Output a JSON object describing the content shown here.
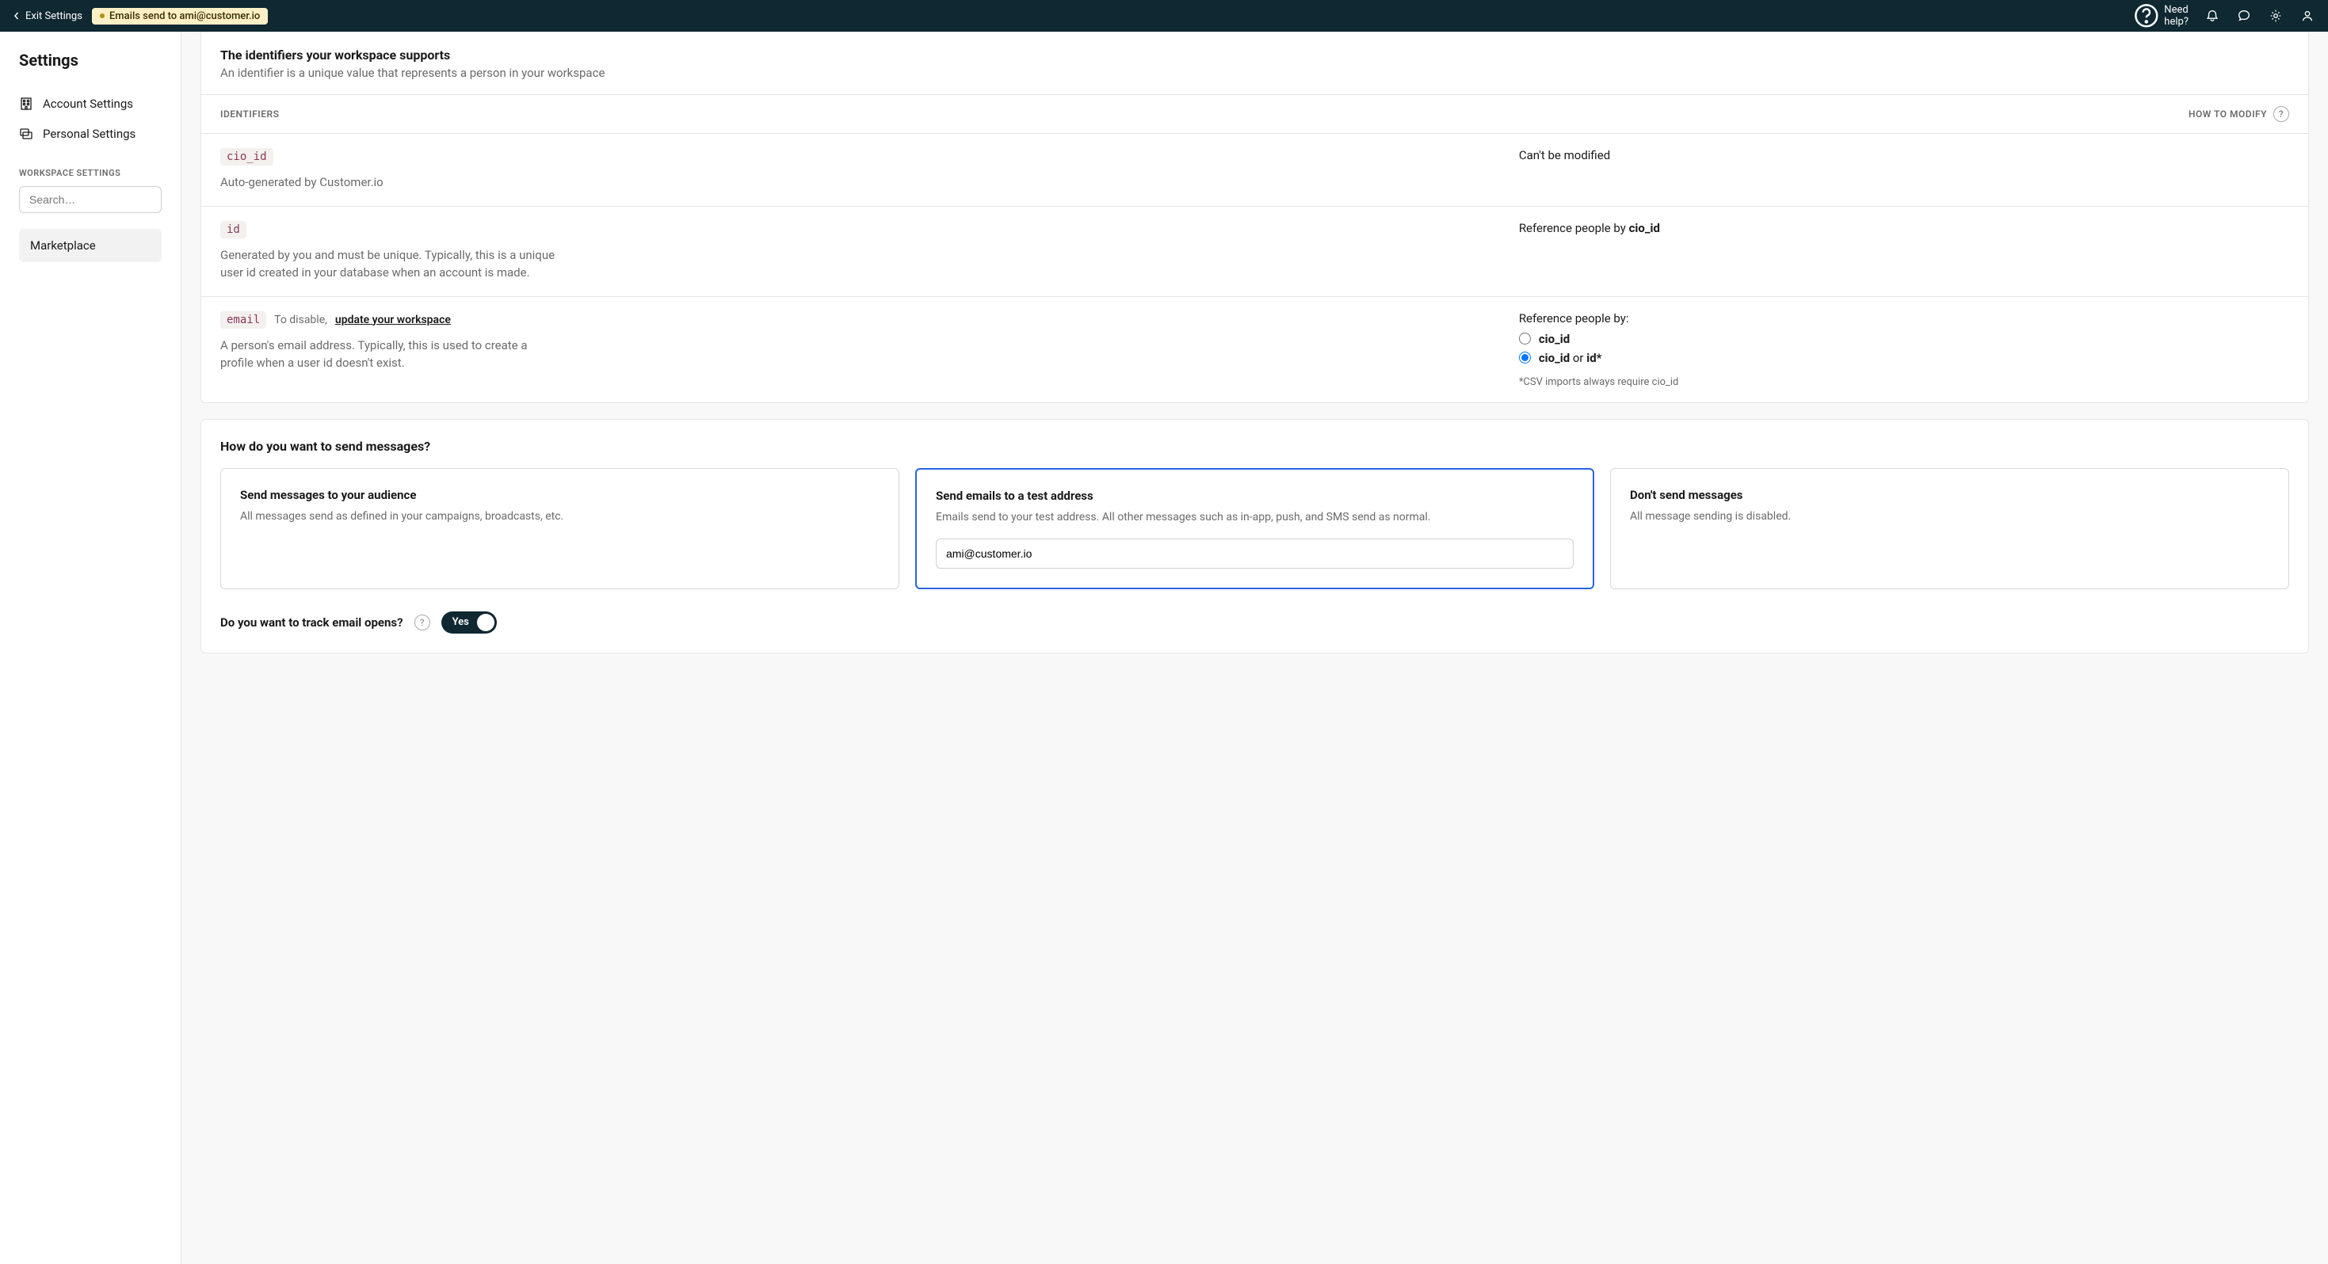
{
  "topbar": {
    "exit": "Exit Settings",
    "badge": "Emails send to ami@customer.io",
    "help": "Need help?"
  },
  "sidebar": {
    "title": "Settings",
    "nav": {
      "account": "Account Settings",
      "personal": "Personal Settings"
    },
    "workspace_label": "WORKSPACE SETTINGS",
    "search_placeholder": "Search…",
    "marketplace": "Marketplace"
  },
  "identifiers": {
    "title": "The identifiers your workspace supports",
    "subtitle": "An identifier is a unique value that represents a person in your workspace",
    "col_left": "IDENTIFIERS",
    "col_right": "HOW TO MODIFY",
    "rows": {
      "cio_id": {
        "tag": "cio_id",
        "desc": "Auto-generated by Customer.io",
        "modify": "Can't be modified"
      },
      "id": {
        "tag": "id",
        "desc": "Generated by you and must be unique. Typically, this is a unique user id created in your database when an account is made.",
        "modify_pre": "Reference people by ",
        "modify_bold": "cio_id"
      },
      "email": {
        "tag": "email",
        "disable_pre": "To disable,",
        "disable_link": "update your workspace",
        "desc": "A person's email address. Typically, this is used to create a profile when a user id doesn't exist.",
        "modify_label": "Reference people by:",
        "radio1": "cio_id",
        "radio2_a": "cio_id",
        "radio2_b": " or ",
        "radio2_c": "id*",
        "footnote": "*CSV imports always require cio_id"
      }
    }
  },
  "send": {
    "title": "How do you want to send messages?",
    "opt1": {
      "title": "Send messages to your audience",
      "desc": "All messages send as defined in your campaigns, broadcasts, etc."
    },
    "opt2": {
      "title": "Send emails to a test address",
      "desc": "Emails send to your test address. All other messages such as in-app, push, and SMS send as normal.",
      "value": "ami@customer.io"
    },
    "opt3": {
      "title": "Don't send messages",
      "desc": "All message sending is disabled."
    }
  },
  "track": {
    "label": "Do you want to track email opens?",
    "value": "Yes"
  }
}
